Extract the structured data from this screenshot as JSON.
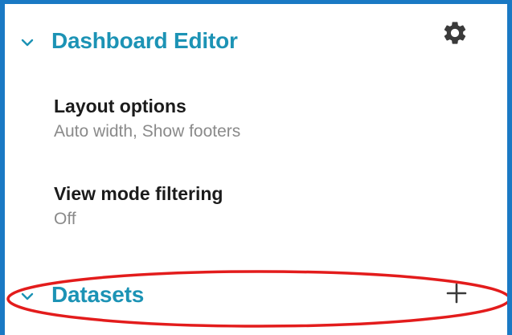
{
  "editor": {
    "title": "Dashboard Editor",
    "chevron_icon": "chevron-down-icon",
    "settings_icon": "gear-icon",
    "accent_color": "#1c93b5"
  },
  "options": [
    {
      "title": "Layout options",
      "value": "Auto width, Show footers"
    },
    {
      "title": "View mode filtering",
      "value": "Off"
    }
  ],
  "datasets": {
    "title": "Datasets",
    "add_icon": "plus-icon",
    "chevron_icon": "chevron-down-icon"
  },
  "highlight": {
    "shape": "ellipse",
    "color": "#e31c1c"
  },
  "frame_color": "#1a79c4"
}
